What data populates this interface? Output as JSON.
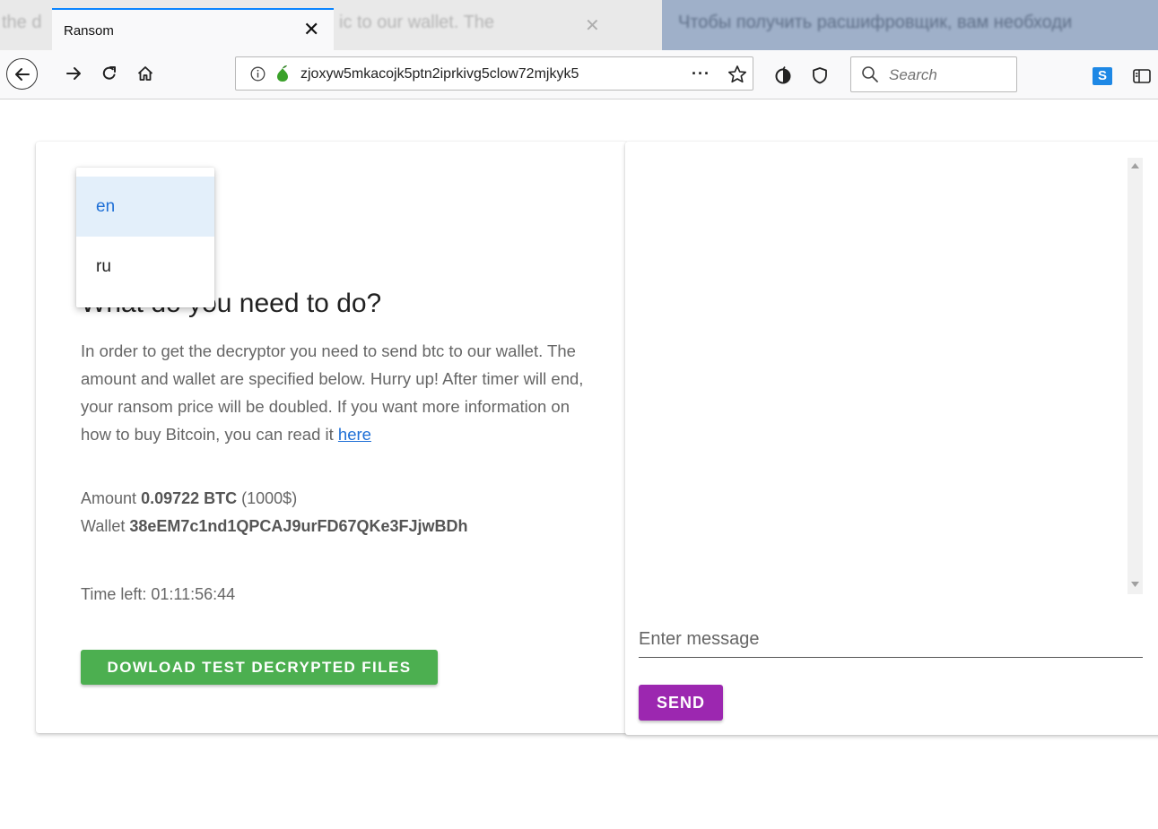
{
  "browser": {
    "background_tabs": {
      "left_text": "the d",
      "middle_text": "ic to our wallet. The",
      "right_text": "Чтобы получить расшифровщик, вам необходи"
    },
    "active_tab": {
      "title": "Ransom",
      "close_glyph": "✕"
    },
    "url": "zjoxyw5mkacojk5ptn2iprkivg5clow72mjkyk5",
    "search_placeholder": "Search",
    "toolbar_icons": [
      "back-icon",
      "forward-icon",
      "reload-icon",
      "home-icon",
      "info-icon",
      "onion-icon",
      "more-icon",
      "star-icon",
      "tor-icon",
      "shield-icon",
      "search-icon",
      "s-extension-icon",
      "sidebar-icon"
    ],
    "accent": "#0a84ff"
  },
  "language_menu": {
    "options": [
      "en",
      "ru"
    ],
    "selected": "en"
  },
  "content": {
    "heading": "What do you need to do?",
    "description": "In order to get the decryptor you need to send btc to our wallet. The amount and wallet are specified below. Hurry up! After timer will end, your ransom price will be doubled. If you want more information on how to buy Bitcoin, you can read it",
    "link_text": "here",
    "amount_label": "Amount",
    "amount_value": "0.09722 BTC",
    "amount_usd": "(1000$)",
    "wallet_label": "Wallet",
    "wallet_value": "38eEM7c1nd1QPCAJ9urFD67QKe3FJjwBDh",
    "time_left_label": "Time left:",
    "time_left_value": "01:11:56:44",
    "download_button": "DOWLOAD TEST DECRYPTED FILES",
    "download_color": "#4caf50"
  },
  "chat": {
    "message_placeholder": "Enter message",
    "send_button": "SEND",
    "send_color": "#9c27b0"
  }
}
